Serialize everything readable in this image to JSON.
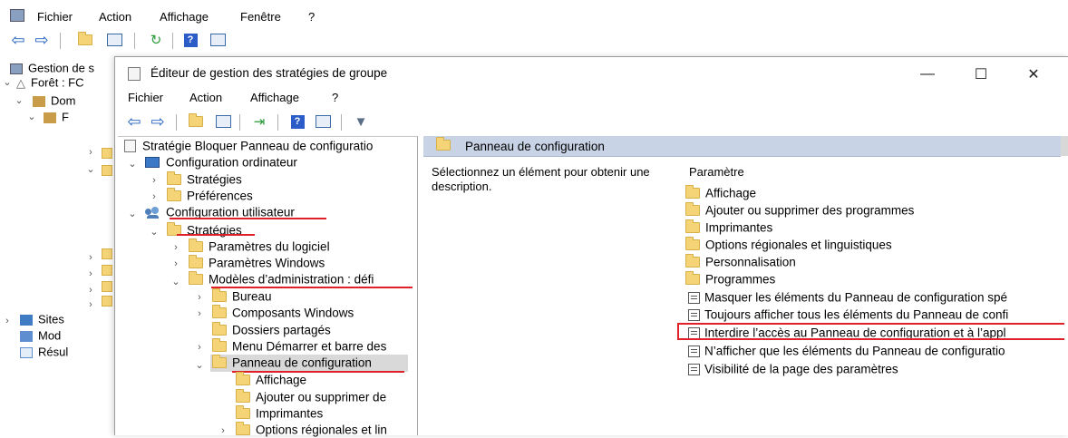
{
  "outer": {
    "menu": [
      "Fichier",
      "Action",
      "Affichage",
      "Fenêtre",
      "?"
    ],
    "tree": [
      "Gestion de s",
      "Forêt : FC",
      "Dom",
      "F",
      "Sites",
      "Mod",
      "Résul"
    ]
  },
  "gpe": {
    "title": "Éditeur de gestion des stratégies de groupe",
    "controls": {
      "minimize": "—",
      "maximize": "☐",
      "close": "✕"
    },
    "menu": [
      "Fichier",
      "Action",
      "Affichage",
      "?"
    ],
    "tree": [
      "Stratégie Bloquer Panneau de configuratio",
      "Configuration ordinateur",
      "Stratégies",
      "Préférences",
      "Configuration utilisateur",
      "Stratégies",
      "Paramètres du logiciel",
      "Paramètres Windows",
      "Modèles d’administration : défi",
      "Bureau",
      "Composants Windows",
      "Dossiers partagés",
      "Menu Démarrer et barre des",
      "Panneau de configuration",
      "Affichage",
      "Ajouter ou supprimer de",
      "Imprimantes",
      "Options régionales et lin"
    ],
    "right": {
      "header": "Panneau de configuration",
      "description": "Sélectionnez un élément pour obtenir une description.",
      "column": "Paramètre",
      "folders": [
        "Affichage",
        "Ajouter ou supprimer des programmes",
        "Imprimantes",
        "Options régionales et linguistiques",
        "Personnalisation",
        "Programmes"
      ],
      "settings": [
        "Masquer les éléments du Panneau de configuration spé",
        "Toujours afficher tous les éléments du Panneau de confi",
        "Interdire l’accès au Panneau de configuration et à l’appl",
        "N’afficher que les éléments du Panneau de configuratio",
        "Visibilité de la page des paramètres"
      ]
    }
  },
  "colors": {
    "highlight": "#e0212a",
    "header": "#c8d4e6",
    "selected": "#d9d9d9",
    "folder": "#f5d477"
  }
}
